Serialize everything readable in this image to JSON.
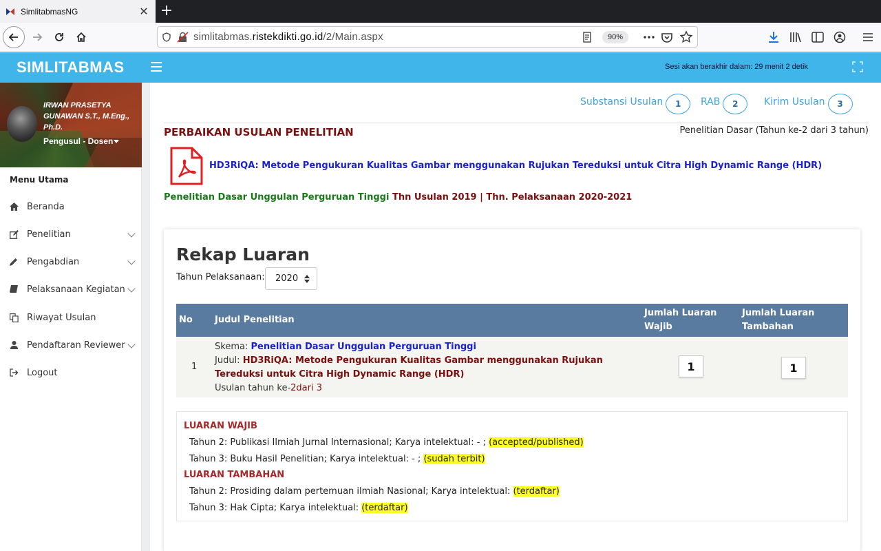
{
  "browser": {
    "tab_title": "SimlitabmasNG",
    "url_domain_prefix": "simlitabmas.",
    "url_domain_main": "ristekdikti.go.id",
    "url_path": "/2/Main.aspx",
    "zoom": "90%"
  },
  "header": {
    "brand": "SIMLITABMAS",
    "session": "Sesi akan berakhir dalam: 29 menit 2 detik"
  },
  "sidebar": {
    "user_name": "IRWAN PRASETYA GUNAWAN S.T., M.Eng., Ph.D.",
    "user_role": "Pengusul - Dosen",
    "menu_heading": "Menu Utama",
    "items": [
      {
        "label": "Beranda",
        "icon": "home-icon",
        "has_children": false
      },
      {
        "label": "Penelitian",
        "icon": "edit-icon",
        "has_children": true
      },
      {
        "label": "Pengabdian",
        "icon": "pencil-icon",
        "has_children": true
      },
      {
        "label": "Pelaksanaan Kegiatan",
        "icon": "book-icon",
        "has_children": true
      },
      {
        "label": "Riwayat Usulan",
        "icon": "copy-icon",
        "has_children": false
      },
      {
        "label": "Pendaftaran Reviewer",
        "icon": "user-icon",
        "has_children": true
      },
      {
        "label": "Logout",
        "icon": "sign-out-icon",
        "has_children": false
      }
    ]
  },
  "steps": [
    {
      "label": "Substansi Usulan",
      "num": "1"
    },
    {
      "label": "RAB",
      "num": "2"
    },
    {
      "label": "Kirim Usulan",
      "num": "3"
    }
  ],
  "page": {
    "heading": "PERBAIKAN USULAN PENELITIAN",
    "scheme_info": "Penelitian Dasar (Tahun ke-2 dari 3 tahun)",
    "proposal_title": "HD3RiQA: Metode Pengukuran Kualitas Gambar menggunakan Rujukan Tereduksi untuk Citra High Dynamic Range (HDR)",
    "meta_scheme": "Penelitian Dasar Unggulan Perguruan Tinggi",
    "meta_years": " Thn Usulan 2019 | Thn. Pelaksanaan 2020-2021"
  },
  "rekap": {
    "title": "Rekap Luaran",
    "year_label": "Tahun Pelaksanaan:",
    "year_value": "2020",
    "columns": [
      "No",
      "Judul Penelitian",
      "Jumlah Luaran Wajib",
      "Jumlah Luaran Tambahan"
    ],
    "row": {
      "no": "1",
      "skema_label": "Skema: ",
      "skema_value": "Penelitian Dasar Unggulan Perguruan Tinggi",
      "judul_label": "Judul: ",
      "judul_value": "HD3RiQA: Metode Pengukuran Kualitas Gambar menggunakan Rujukan Tereduksi untuk Citra High Dynamic Range (HDR)",
      "usulan_prefix": "Usulan tahun ke-",
      "usulan_value": "2dari 3",
      "wajib_count": "1",
      "tambahan_count": "1"
    }
  },
  "luaran": {
    "wajib_heading": "LUARAN WAJIB",
    "wajib": [
      {
        "text": "Tahun 2: Publikasi Ilmiah Jurnal Internasional; Karya intelektual: - ; ",
        "status": "(accepted/published)"
      },
      {
        "text": "Tahun 3: Buku Hasil Penelitian; Karya intelektual: - ; ",
        "status": "(sudah terbit)"
      }
    ],
    "tambahan_heading": "LUARAN TAMBAHAN",
    "tambahan": [
      {
        "text": "Tahun 2: Prosiding dalam pertemuan ilmiah Nasional; Karya intelektual: ",
        "status": "(terdaftar)"
      },
      {
        "text": "Tahun 3: Hak Cipta; Karya intelektual: ",
        "status": "(terdaftar)"
      }
    ]
  },
  "colors": {
    "header_blue": "#3fb5ea",
    "table_head": "#5a7ba0",
    "heading_red": "#7a1010",
    "link_blue": "#1a22cc",
    "highlight": "#ffff22"
  }
}
